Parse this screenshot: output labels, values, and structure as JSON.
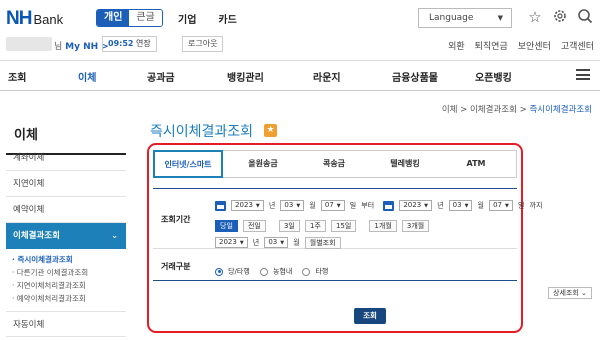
{
  "header": {
    "logo_nh": "NH",
    "logo_bank": "Bank",
    "segment": [
      "개인",
      "큰글"
    ],
    "topnav": [
      "기업",
      "카드"
    ],
    "language": "Language",
    "icons": [
      "star-icon",
      "gear-icon",
      "search-icon"
    ]
  },
  "userbar": {
    "suffix": "님",
    "my_nh": "My NH",
    "my_nh_arrow": ">",
    "session_time": "09:52",
    "extend_label": "연장",
    "logout_label": "로그아웃",
    "util_links": [
      "외환",
      "퇴직연금",
      "보안센터",
      "고객센터"
    ]
  },
  "mainnav": [
    "조회",
    "이체",
    "공과금",
    "뱅킹관리",
    "라운지",
    "금융상품몰",
    "오픈뱅킹"
  ],
  "sidebar": {
    "title": "이체",
    "items": [
      "계좌이체",
      "지연이체",
      "예약이체",
      "이체결과조회",
      "자동이체"
    ],
    "sub_items": [
      "· 즉시이체결과조회",
      "· 다른기관 이체결과조회",
      "· 지연이체처리결과조회",
      "· 예약이체처리결과조회"
    ]
  },
  "breadcrumb": [
    "이체",
    "이체결과조회",
    "즉시이체결과조회"
  ],
  "breadcrumb_sep": ">",
  "page_title": "즉시이체결과조회",
  "page_title_star": "★",
  "tabs": [
    "인터넷/스마트",
    "올원송금",
    "콕송금",
    "텔레뱅킹",
    "ATM"
  ],
  "form": {
    "period_label": "조회기간",
    "from": {
      "year": "2023",
      "month": "03",
      "day": "07"
    },
    "to": {
      "year": "2023",
      "month": "03",
      "day": "07"
    },
    "unit_year": "년",
    "unit_month": "월",
    "unit_day": "일",
    "from_suffix": "부터",
    "to_suffix": "까지",
    "period_buttons": [
      "당일",
      "전일",
      "3일",
      "1주",
      "15일",
      "1개월",
      "3개월"
    ],
    "monthly": {
      "year": "2023",
      "month": "03",
      "button": "월별조회"
    },
    "type_label": "거래구분",
    "type_options": [
      "당/타행",
      "농협내",
      "타행"
    ],
    "type_selected": 0,
    "detail_label": "상세조회",
    "submit_label": "조회"
  },
  "colors": {
    "brand": "#1c5fb8",
    "highlight": "#e31c25",
    "sidebar_active": "#1d80b8"
  }
}
